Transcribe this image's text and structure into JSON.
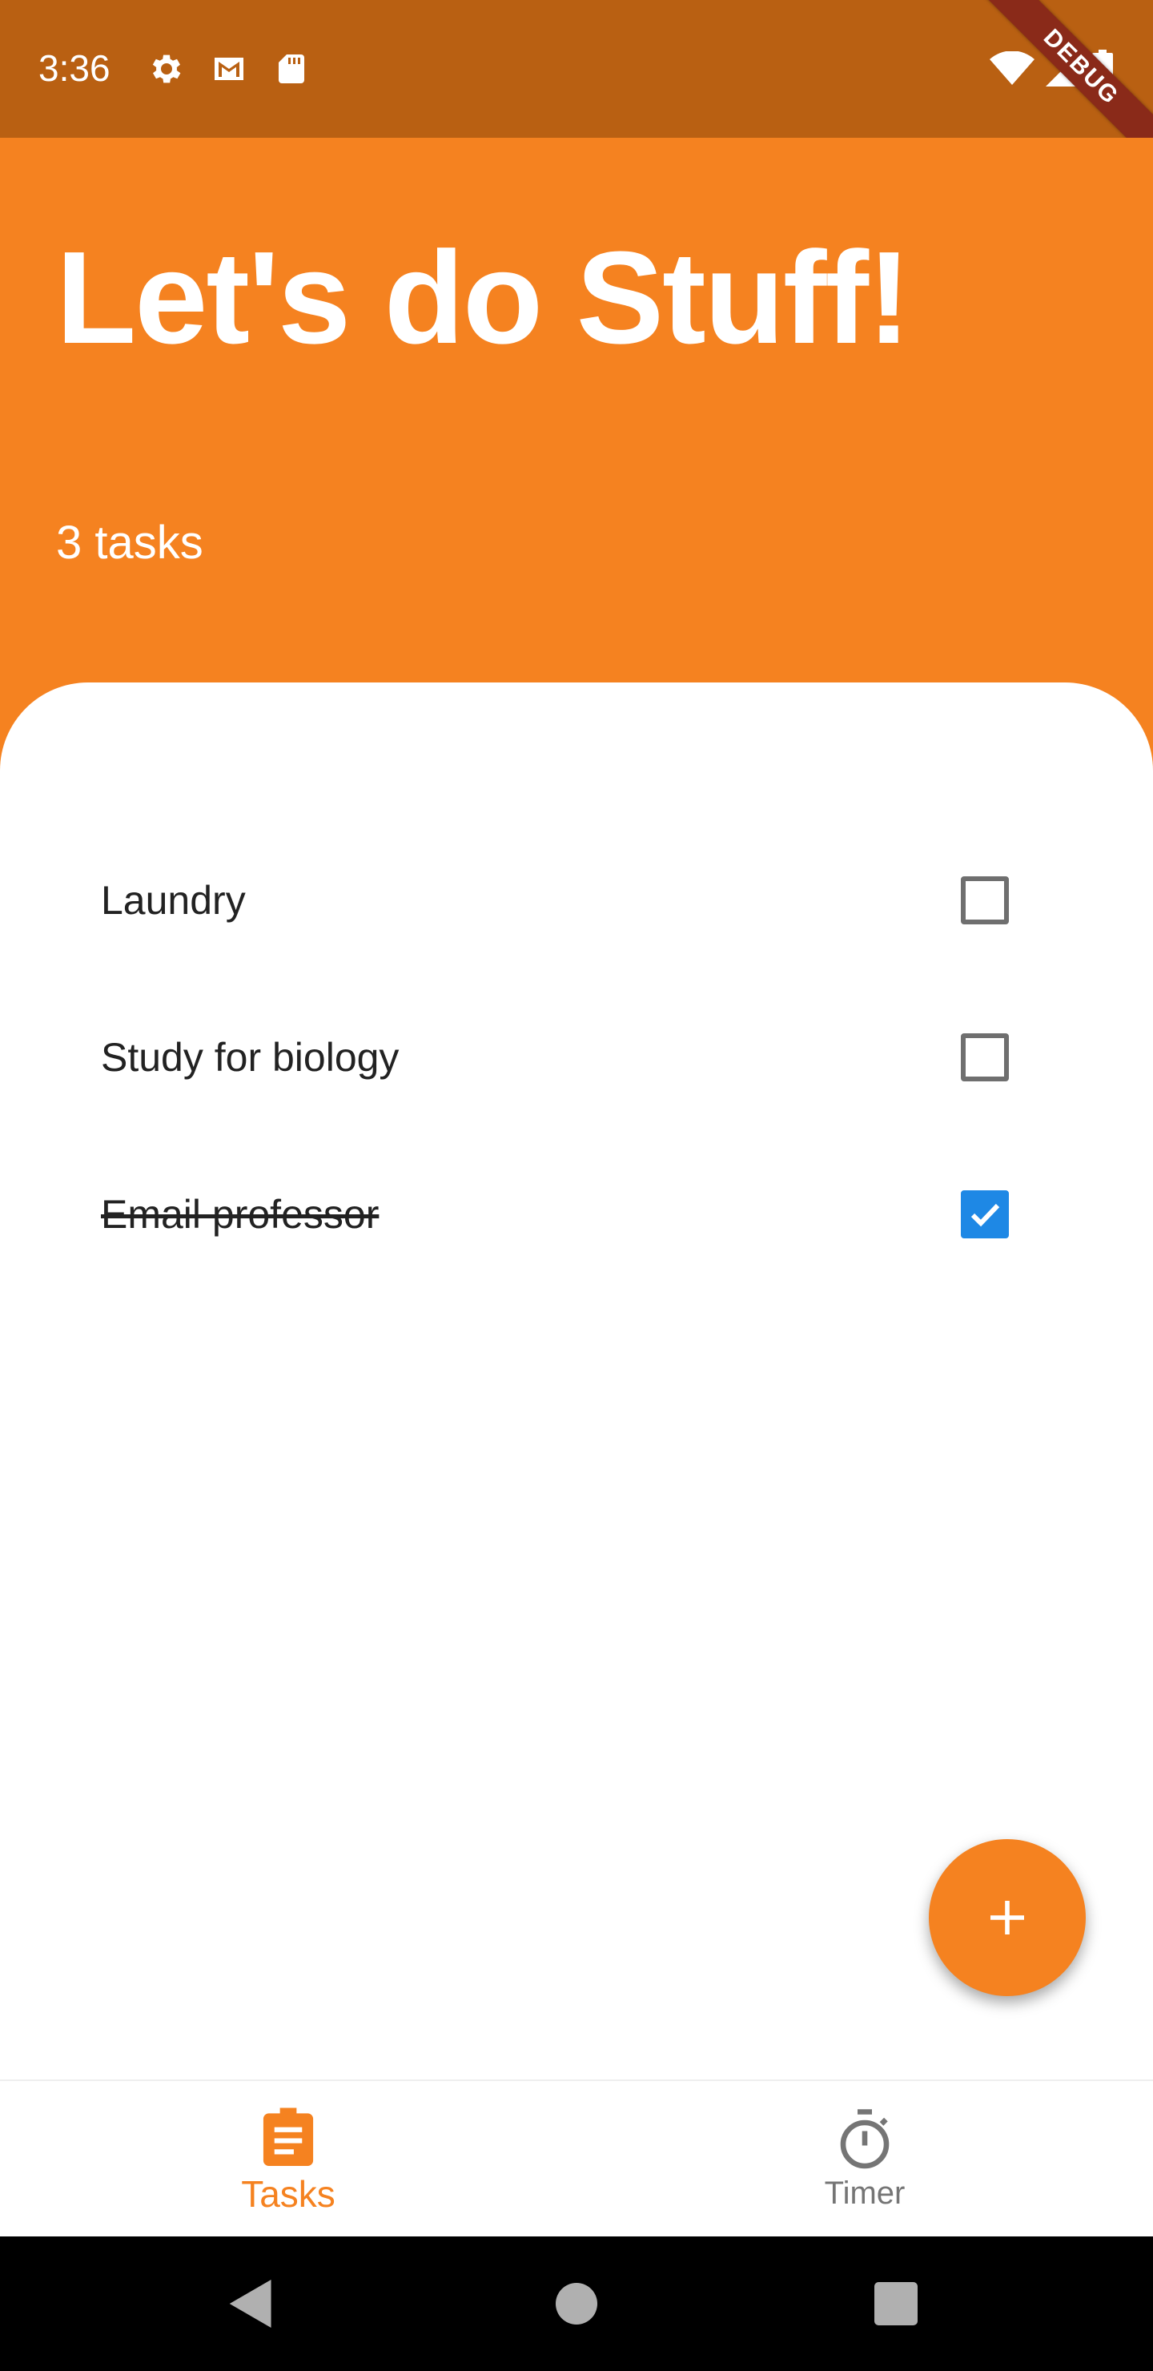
{
  "status_bar": {
    "time": "3:36",
    "debug_label": "DEBUG"
  },
  "header": {
    "title": "Let's do Stuff!",
    "subtitle": "3 tasks"
  },
  "tasks": [
    {
      "label": "Laundry",
      "checked": false
    },
    {
      "label": "Study for biology",
      "checked": false
    },
    {
      "label": "Email professor",
      "checked": true
    }
  ],
  "fab": {
    "icon": "plus-icon"
  },
  "bottom_nav": {
    "items": [
      {
        "label": "Tasks",
        "icon": "clipboard-icon",
        "active": true
      },
      {
        "label": "Timer",
        "icon": "stopwatch-icon",
        "active": false
      }
    ]
  },
  "colors": {
    "accent": "#f58220",
    "status_bar": "#b96012",
    "checkbox_checked": "#1e88e5",
    "inactive_nav": "#757575"
  }
}
